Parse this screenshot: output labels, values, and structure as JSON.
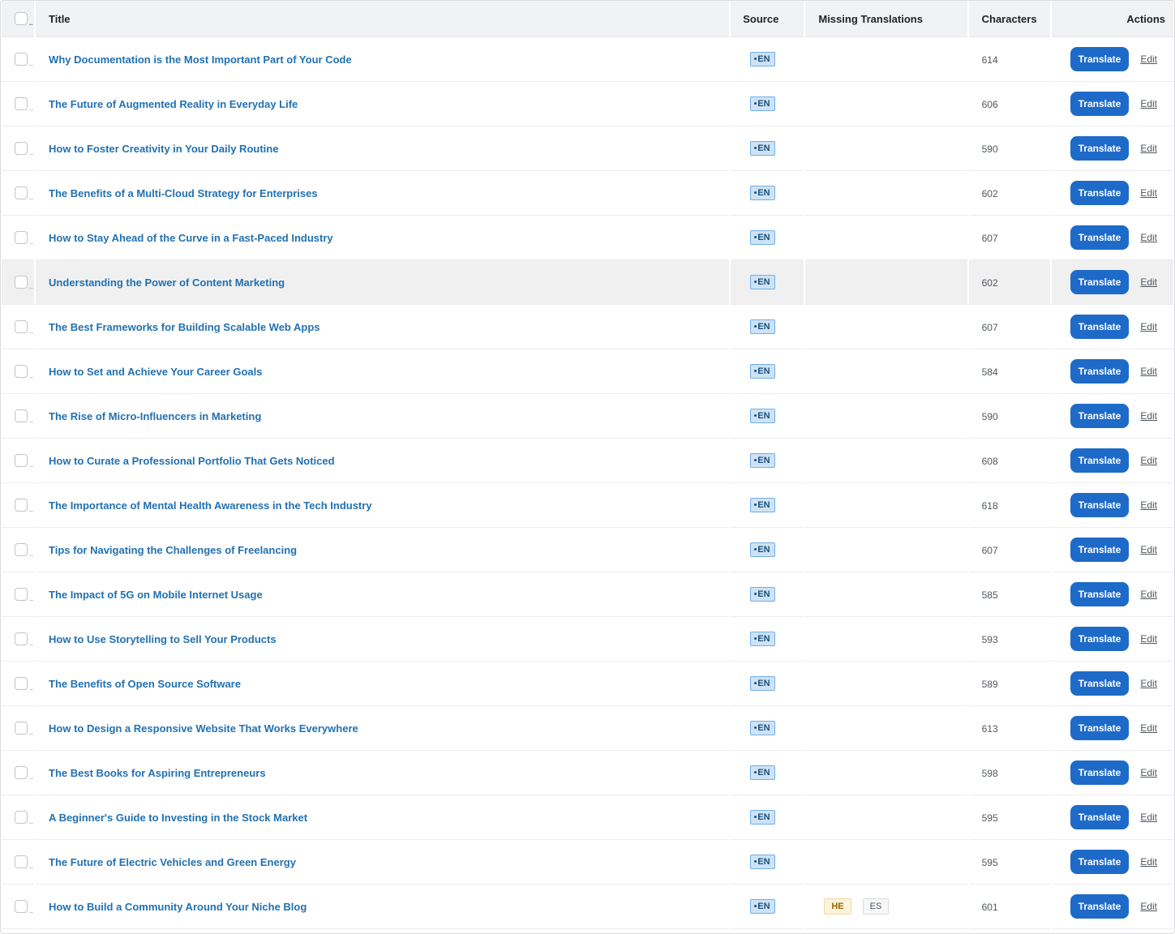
{
  "columns": {
    "title": "Title",
    "source": "Source",
    "missing": "Missing Translations",
    "characters": "Characters",
    "actions": "Actions"
  },
  "labels": {
    "translate": "Translate",
    "edit": "Edit"
  },
  "rows": [
    {
      "title": "Why Documentation is the Most Important Part of Your Code",
      "source": "EN",
      "chars": "614",
      "missing": []
    },
    {
      "title": "The Future of Augmented Reality in Everyday Life",
      "source": "EN",
      "chars": "606",
      "missing": []
    },
    {
      "title": "How to Foster Creativity in Your Daily Routine",
      "source": "EN",
      "chars": "590",
      "missing": []
    },
    {
      "title": "The Benefits of a Multi-Cloud Strategy for Enterprises",
      "source": "EN",
      "chars": "602",
      "missing": []
    },
    {
      "title": "How to Stay Ahead of the Curve in a Fast-Paced Industry",
      "source": "EN",
      "chars": "607",
      "missing": []
    },
    {
      "title": "Understanding the Power of Content Marketing",
      "source": "EN",
      "chars": "602",
      "missing": [],
      "hover": true
    },
    {
      "title": "The Best Frameworks for Building Scalable Web Apps",
      "source": "EN",
      "chars": "607",
      "missing": []
    },
    {
      "title": "How to Set and Achieve Your Career Goals",
      "source": "EN",
      "chars": "584",
      "missing": []
    },
    {
      "title": "The Rise of Micro-Influencers in Marketing",
      "source": "EN",
      "chars": "590",
      "missing": []
    },
    {
      "title": "How to Curate a Professional Portfolio That Gets Noticed",
      "source": "EN",
      "chars": "608",
      "missing": []
    },
    {
      "title": "The Importance of Mental Health Awareness in the Tech Industry",
      "source": "EN",
      "chars": "618",
      "missing": []
    },
    {
      "title": "Tips for Navigating the Challenges of Freelancing",
      "source": "EN",
      "chars": "607",
      "missing": []
    },
    {
      "title": "The Impact of 5G on Mobile Internet Usage",
      "source": "EN",
      "chars": "585",
      "missing": []
    },
    {
      "title": "How to Use Storytelling to Sell Your Products",
      "source": "EN",
      "chars": "593",
      "missing": []
    },
    {
      "title": "The Benefits of Open Source Software",
      "source": "EN",
      "chars": "589",
      "missing": []
    },
    {
      "title": "How to Design a Responsive Website That Works Everywhere",
      "source": "EN",
      "chars": "613",
      "missing": []
    },
    {
      "title": "The Best Books for Aspiring Entrepreneurs",
      "source": "EN",
      "chars": "598",
      "missing": []
    },
    {
      "title": "A Beginner's Guide to Investing in the Stock Market",
      "source": "EN",
      "chars": "595",
      "missing": []
    },
    {
      "title": "The Future of Electric Vehicles and Green Energy",
      "source": "EN",
      "chars": "595",
      "missing": []
    },
    {
      "title": "How to Build a Community Around Your Niche Blog",
      "source": "EN",
      "chars": "601",
      "missing": [
        "HE",
        "ES"
      ]
    }
  ]
}
